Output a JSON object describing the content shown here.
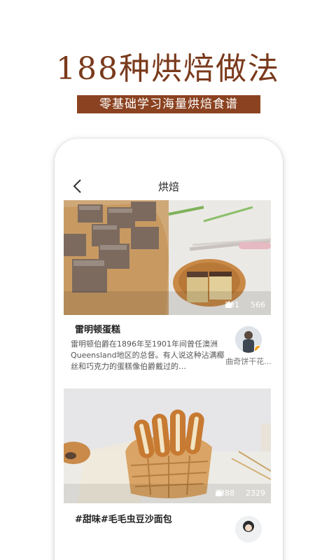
{
  "promo": {
    "headline": "188种烘焙做法",
    "subtitle": "零基础学习海量烘焙食谱"
  },
  "nav": {
    "title": "烘焙",
    "back_icon": "chevron-left-icon"
  },
  "recipes": [
    {
      "title": "雷明顿蛋糕",
      "description": "雷明顿伯爵在1896年至1901年间曾任澳洲Queensland地区的总督。有人说这种沾满椰丝和巧克力的蛋糕像伯爵戴过的…",
      "likes": "131",
      "favorites": "566",
      "author_name": "曲奇饼干花..."
    },
    {
      "title": "#甜味#毛毛虫豆沙面包",
      "likes": "1388",
      "favorites": "2329"
    }
  ],
  "colors": {
    "headline": "#7a3a1c",
    "banner": "#8b4220",
    "badge": "#f0a020"
  }
}
